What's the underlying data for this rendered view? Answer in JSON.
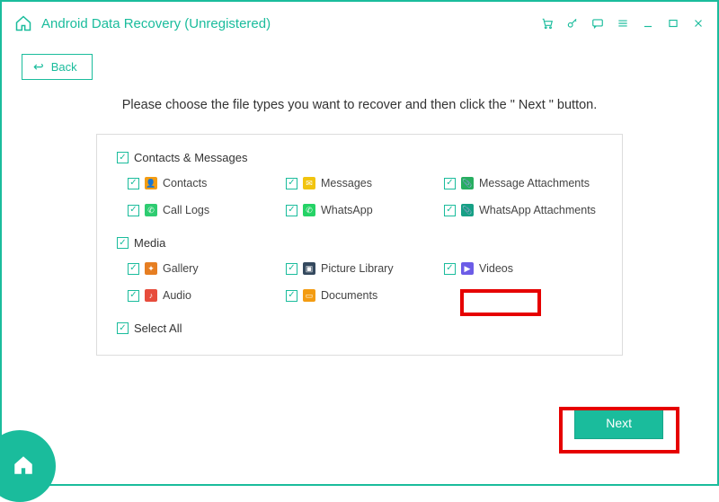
{
  "titlebar": {
    "app_title": "Android Data Recovery (Unregistered)"
  },
  "back_label": "Back",
  "instruction": "Please choose the file types you want to recover and then click the \" Next \" button.",
  "sections": {
    "contacts_messages": {
      "header": "Contacts & Messages",
      "items": {
        "contacts": "Contacts",
        "messages": "Messages",
        "msg_attachments": "Message Attachments",
        "call_logs": "Call Logs",
        "whatsapp": "WhatsApp",
        "whatsapp_attachments": "WhatsApp Attachments"
      }
    },
    "media": {
      "header": "Media",
      "items": {
        "gallery": "Gallery",
        "picture_library": "Picture Library",
        "videos": "Videos",
        "audio": "Audio",
        "documents": "Documents"
      }
    }
  },
  "select_all_label": "Select All",
  "next_label": "Next",
  "colors": {
    "accent": "#1abc9c",
    "highlight": "#e60000"
  }
}
